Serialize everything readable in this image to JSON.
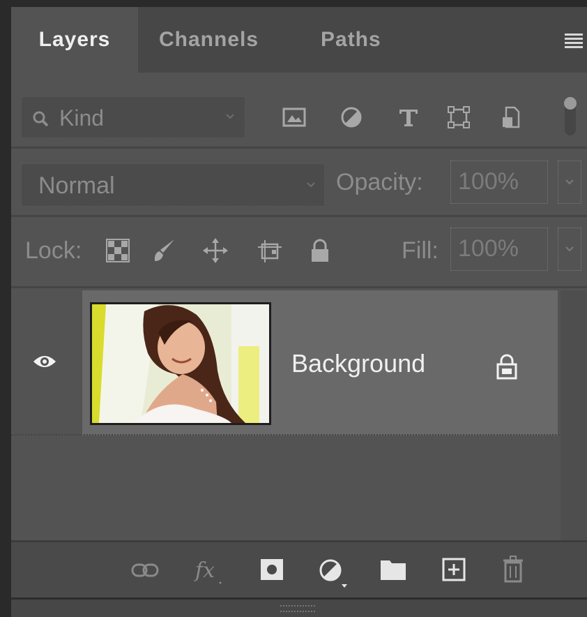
{
  "panel": {
    "tabs": [
      {
        "label": "Layers",
        "active": true
      },
      {
        "label": "Channels",
        "active": false
      },
      {
        "label": "Paths",
        "active": false
      }
    ],
    "menu_icon": "hamburger-menu-icon"
  },
  "filter": {
    "kind_label": "Kind",
    "icons": [
      "pixel-layer-filter-icon",
      "adjustment-layer-filter-icon",
      "type-layer-filter-icon",
      "shape-layer-filter-icon",
      "smart-object-filter-icon"
    ],
    "toggle_icon": "filter-toggle-icon"
  },
  "blend": {
    "mode": "Normal",
    "opacity_label": "Opacity:",
    "opacity_value": "100%"
  },
  "lock": {
    "label": "Lock:",
    "icons": [
      "lock-transparent-pixels-icon",
      "lock-image-pixels-icon",
      "lock-position-icon",
      "lock-artboard-icon",
      "lock-all-icon"
    ],
    "fill_label": "Fill:",
    "fill_value": "100%"
  },
  "layers": [
    {
      "name": "Background",
      "visible": true,
      "locked": true,
      "thumbnail": "bride-photo-thumbnail"
    }
  ],
  "bottom_toolbar": {
    "icons": [
      "link-layers-icon",
      "layer-style-fx-icon",
      "add-mask-icon",
      "new-fill-adjustment-icon",
      "new-group-folder-icon",
      "new-layer-icon",
      "delete-layer-trash-icon"
    ]
  },
  "colors": {
    "panel_bg": "#535353",
    "tabbar_bg": "#474747",
    "selected_layer_bg": "#696969",
    "text_active": "#efefef",
    "text_dim": "#8c8c8c"
  }
}
